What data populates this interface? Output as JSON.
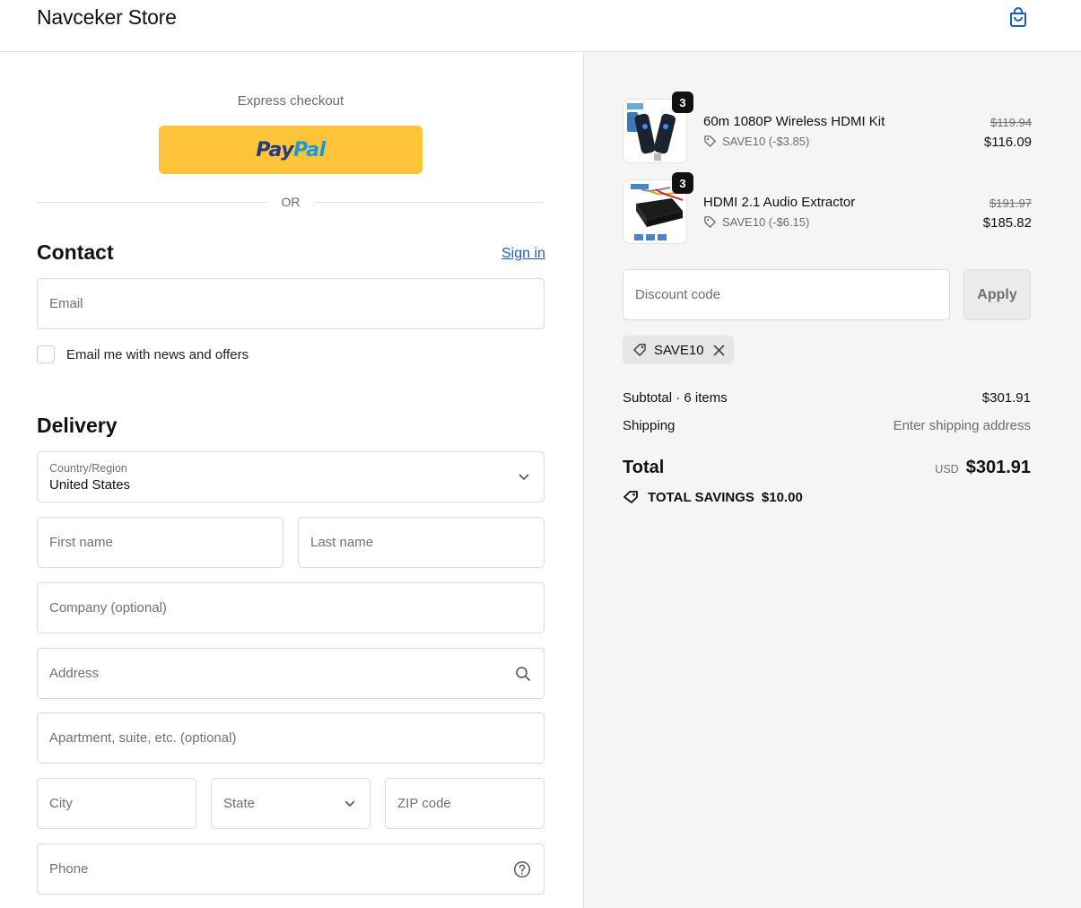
{
  "header": {
    "store_name": "Navceker Store",
    "cart_icon": "shopping-bag-icon"
  },
  "express": {
    "label": "Express checkout",
    "paypal_icon": "paypal-logo",
    "paypal_pay": "Pay",
    "paypal_pal": "Pal",
    "or": "OR"
  },
  "contact": {
    "title": "Contact",
    "sign_in": "Sign in",
    "email_placeholder": "Email",
    "newsletter_label": "Email me with news and offers"
  },
  "delivery": {
    "title": "Delivery",
    "country_label": "Country/Region",
    "country_value": "United States",
    "first_name": "First name",
    "last_name": "Last name",
    "company": "Company (optional)",
    "address": "Address",
    "apartment": "Apartment, suite, etc. (optional)",
    "city": "City",
    "state": "State",
    "zip": "ZIP code",
    "phone": "Phone"
  },
  "summary": {
    "items": [
      {
        "name": "60m 1080P Wireless HDMI Kit",
        "qty": "3",
        "discount": "SAVE10 (-$3.85)",
        "old_price": "$119.94",
        "price": "$116.09"
      },
      {
        "name": "HDMI 2.1 Audio Extractor",
        "qty": "3",
        "discount": "SAVE10 (-$6.15)",
        "old_price": "$191.97",
        "price": "$185.82"
      }
    ],
    "discount_placeholder": "Discount code",
    "apply_label": "Apply",
    "applied_code": "SAVE10",
    "subtotal_label": "Subtotal · 6 items",
    "subtotal_value": "$301.91",
    "shipping_label": "Shipping",
    "shipping_value": "Enter shipping address",
    "total_label": "Total",
    "currency": "USD",
    "total_value": "$301.91",
    "savings_label": "TOTAL SAVINGS",
    "savings_value": "$10.00"
  },
  "colors": {
    "paypal_yellow": "#ffc439",
    "link_blue": "#1a5fb4",
    "summary_bg": "#f5f5f5"
  }
}
